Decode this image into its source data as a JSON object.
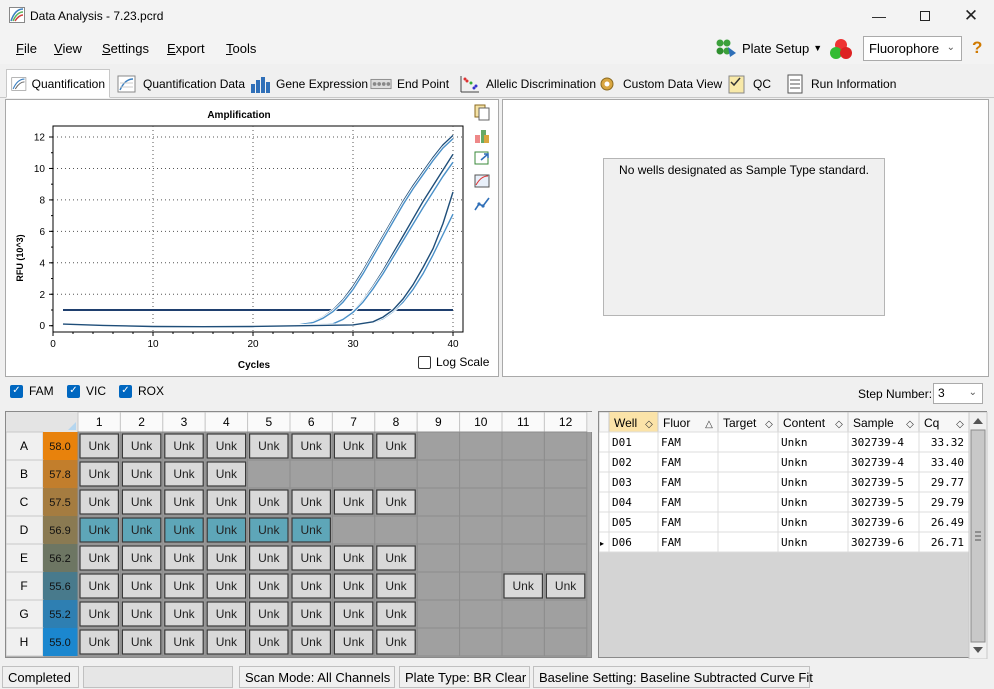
{
  "window": {
    "title": "Data Analysis - 7.23.pcrd"
  },
  "menu": {
    "file": "File",
    "view": "View",
    "settings": "Settings",
    "export": "Export",
    "tools": "Tools"
  },
  "toolbar": {
    "plate_setup": "Plate Setup",
    "fluorophore": "Fluorophore"
  },
  "tabs": [
    {
      "label": "Quantification",
      "icon": "amplification-icon"
    },
    {
      "label": "Quantification Data",
      "icon": "data-sheet-icon"
    },
    {
      "label": "Gene Expression",
      "icon": "bar-chart-icon"
    },
    {
      "label": "End Point",
      "icon": "end-point-icon"
    },
    {
      "label": "Allelic Discrimination",
      "icon": "scatter-icon"
    },
    {
      "label": "Custom Data View",
      "icon": "gear-icon"
    },
    {
      "label": "QC",
      "icon": "checklist-icon"
    },
    {
      "label": "Run Information",
      "icon": "document-icon"
    }
  ],
  "chart_data": {
    "type": "line",
    "title": "Amplification",
    "xlabel": "Cycles",
    "ylabel": "RFU (10^3)",
    "xlim": [
      0,
      41
    ],
    "ylim": [
      -0.4,
      12.7
    ],
    "xticks": [
      0,
      10,
      20,
      30,
      40
    ],
    "yticks": [
      0,
      2,
      4,
      6,
      8,
      10,
      12
    ],
    "threshold": 1.0,
    "grid": true,
    "log_scale_label": "Log Scale",
    "series": [
      {
        "x": [
          1,
          5,
          10,
          15,
          20,
          24,
          26,
          27,
          28,
          29,
          30,
          31,
          32,
          33,
          34,
          35,
          36,
          37,
          38,
          39,
          40
        ],
        "values": [
          0.1,
          0.02,
          -0.05,
          -0.06,
          -0.05,
          0.0,
          0.25,
          0.55,
          1.0,
          1.65,
          2.5,
          3.5,
          4.6,
          5.7,
          6.8,
          7.9,
          8.9,
          9.8,
          10.7,
          11.5,
          12.1
        ],
        "color": "#1f4e79"
      },
      {
        "x": [
          1,
          5,
          10,
          15,
          20,
          24,
          26,
          27,
          28,
          29,
          30,
          31,
          32,
          33,
          34,
          35,
          36,
          37,
          38,
          39,
          40
        ],
        "values": [
          0.1,
          0.02,
          -0.05,
          -0.06,
          -0.05,
          0.0,
          0.2,
          0.48,
          0.9,
          1.5,
          2.3,
          3.3,
          4.4,
          5.5,
          6.6,
          7.7,
          8.7,
          9.6,
          10.5,
          11.3,
          11.9
        ],
        "color": "#4a90c8"
      },
      {
        "x": [
          1,
          5,
          10,
          15,
          20,
          25,
          28,
          29,
          30,
          31,
          32,
          33,
          34,
          35,
          36,
          37,
          38,
          39,
          40
        ],
        "values": [
          0.1,
          0.02,
          -0.05,
          -0.06,
          -0.05,
          0.0,
          0.15,
          0.45,
          0.9,
          1.6,
          2.5,
          3.5,
          4.6,
          5.7,
          6.8,
          7.9,
          8.9,
          9.9,
          10.9
        ],
        "color": "#1f4e79"
      },
      {
        "x": [
          1,
          5,
          10,
          15,
          20,
          25,
          28,
          29,
          30,
          31,
          32,
          33,
          34,
          35,
          36,
          37,
          38,
          39,
          40
        ],
        "values": [
          0.1,
          0.02,
          -0.05,
          -0.06,
          -0.05,
          0.0,
          0.12,
          0.4,
          0.85,
          1.5,
          2.35,
          3.3,
          4.35,
          5.4,
          6.45,
          7.5,
          8.5,
          9.5,
          10.4
        ],
        "color": "#4a90c8"
      },
      {
        "x": [
          1,
          5,
          10,
          15,
          20,
          25,
          30,
          32,
          33,
          34,
          35,
          36,
          37,
          38,
          39,
          40
        ],
        "values": [
          0.1,
          0.02,
          -0.05,
          -0.06,
          -0.05,
          0.0,
          0.05,
          0.2,
          0.45,
          0.9,
          1.5,
          2.3,
          3.3,
          4.5,
          5.8,
          7.1
        ],
        "color": "#4a90c8"
      },
      {
        "x": [
          1,
          5,
          10,
          15,
          20,
          25,
          30,
          32,
          33,
          34,
          35,
          36,
          37,
          38,
          39,
          40
        ],
        "values": [
          0.1,
          0.02,
          -0.05,
          -0.06,
          -0.05,
          0.0,
          0.05,
          0.25,
          0.55,
          1.0,
          1.7,
          2.6,
          3.7,
          4.9,
          6.5,
          8.5
        ],
        "color": "#1f4e79"
      }
    ]
  },
  "standard_curve": {
    "message": "No wells designated as Sample Type standard."
  },
  "filters": {
    "fam": "FAM",
    "vic": "VIC",
    "rox": "ROX",
    "step_label": "Step Number:",
    "step_value": "3"
  },
  "plate": {
    "columns": [
      "1",
      "2",
      "3",
      "4",
      "5",
      "6",
      "7",
      "8",
      "9",
      "10",
      "11",
      "12"
    ],
    "rows": [
      {
        "label": "A",
        "temp": "58.0",
        "color": "#e8820c",
        "wells": [
          "Unk",
          "Unk",
          "Unk",
          "Unk",
          "Unk",
          "Unk",
          "Unk",
          "Unk",
          "",
          "",
          "",
          ""
        ]
      },
      {
        "label": "B",
        "temp": "57.8",
        "color": "#c27e2c",
        "wells": [
          "Unk",
          "Unk",
          "Unk",
          "Unk",
          "",
          "",
          "",
          "",
          "",
          "",
          "",
          ""
        ]
      },
      {
        "label": "C",
        "temp": "57.5",
        "color": "#a57c40",
        "wells": [
          "Unk",
          "Unk",
          "Unk",
          "Unk",
          "Unk",
          "Unk",
          "Unk",
          "Unk",
          "",
          "",
          "",
          ""
        ]
      },
      {
        "label": "D",
        "temp": "56.9",
        "color": "#8a7a52",
        "wells": [
          "Unk",
          "Unk",
          "Unk",
          "Unk",
          "Unk",
          "Unk",
          "",
          "",
          "",
          "",
          "",
          ""
        ],
        "highlight": 6
      },
      {
        "label": "E",
        "temp": "56.2",
        "color": "#6d7663",
        "wells": [
          "Unk",
          "Unk",
          "Unk",
          "Unk",
          "Unk",
          "Unk",
          "Unk",
          "Unk",
          "",
          "",
          "",
          ""
        ]
      },
      {
        "label": "F",
        "temp": "55.6",
        "color": "#487a8c",
        "wells": [
          "Unk",
          "Unk",
          "Unk",
          "Unk",
          "Unk",
          "Unk",
          "Unk",
          "Unk",
          "",
          "",
          "Unk",
          "Unk"
        ]
      },
      {
        "label": "G",
        "temp": "55.2",
        "color": "#2e7fb2",
        "wells": [
          "Unk",
          "Unk",
          "Unk",
          "Unk",
          "Unk",
          "Unk",
          "Unk",
          "Unk",
          "",
          "",
          "",
          ""
        ]
      },
      {
        "label": "H",
        "temp": "55.0",
        "color": "#1b87cf",
        "wells": [
          "Unk",
          "Unk",
          "Unk",
          "Unk",
          "Unk",
          "Unk",
          "Unk",
          "Unk",
          "",
          "",
          "",
          ""
        ]
      }
    ]
  },
  "results_table": {
    "headers": [
      "Well",
      "Fluor",
      "Target",
      "Content",
      "Sample",
      "Cq"
    ],
    "rows": [
      [
        "D01",
        "FAM",
        "",
        "Unkn",
        "302739-4",
        "33.32"
      ],
      [
        "D02",
        "FAM",
        "",
        "Unkn",
        "302739-4",
        "33.40"
      ],
      [
        "D03",
        "FAM",
        "",
        "Unkn",
        "302739-5",
        "29.77"
      ],
      [
        "D04",
        "FAM",
        "",
        "Unkn",
        "302739-5",
        "29.79"
      ],
      [
        "D05",
        "FAM",
        "",
        "Unkn",
        "302739-6",
        "26.49"
      ],
      [
        "D06",
        "FAM",
        "",
        "Unkn",
        "302739-6",
        "26.71"
      ]
    ]
  },
  "status": {
    "state": "Completed",
    "scan_mode": "Scan Mode: All Channels",
    "plate_type": "Plate Type: BR Clear",
    "baseline": "Baseline Setting: Baseline Subtracted Curve Fit"
  }
}
